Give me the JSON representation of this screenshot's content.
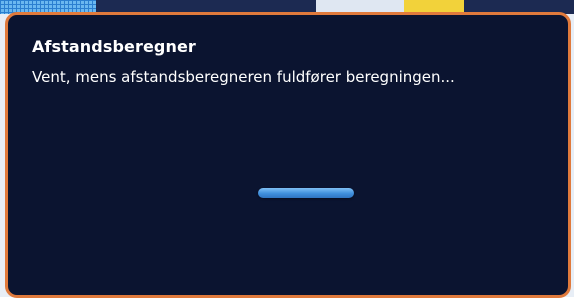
{
  "dialog": {
    "title": "Afstandsberegner",
    "message": "Vent, mens afstandsberegneren fuldfører beregningen...",
    "progress": {
      "state": "indeterminate"
    }
  },
  "colors": {
    "dialog_background": "#0b1430",
    "dialog_border": "#e07a3c",
    "progress_bar": "#3f8fdc",
    "text": "#ffffff"
  }
}
